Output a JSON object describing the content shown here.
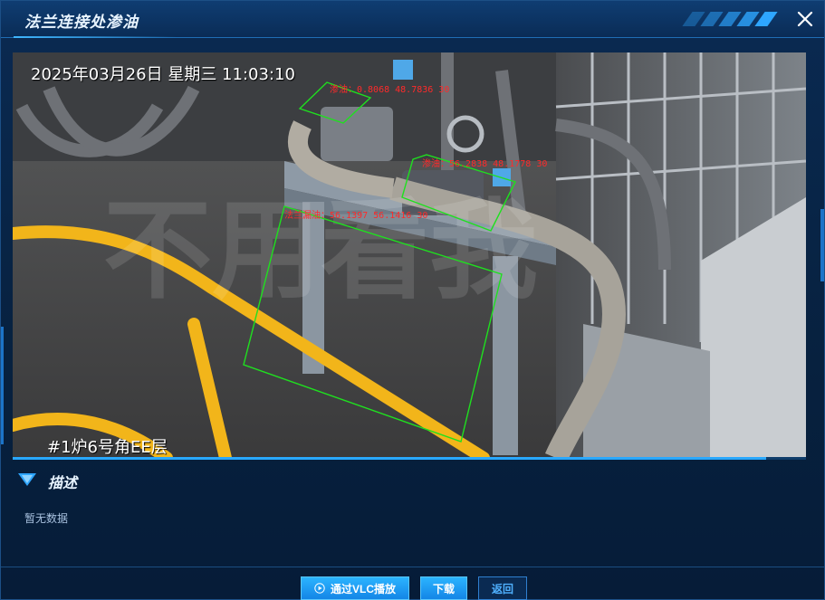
{
  "window": {
    "title": "法兰连接处渗油"
  },
  "video": {
    "timestamp": "2025年03月26日  星期三  11:03:10",
    "camera_label": "#1炉6号角EE层",
    "progress": 0.95,
    "watermark": "不用看我",
    "detections": [
      {
        "label": "渗油：0.8068 48.7836 30"
      },
      {
        "label": "渗油：56.2838 48.1778 30"
      },
      {
        "label": "法兰漏油：56.1397 56.1416 30"
      }
    ]
  },
  "description": {
    "title": "描述",
    "content": "暂无数据"
  },
  "buttons": {
    "vlc": "通过VLC播放",
    "download": "下载",
    "back": "返回"
  },
  "colors": {
    "accent": "#29a8ff",
    "title_bg": "#0f3d72",
    "detection_box": "#1fe01f",
    "detection_text": "#ff2a2a"
  }
}
